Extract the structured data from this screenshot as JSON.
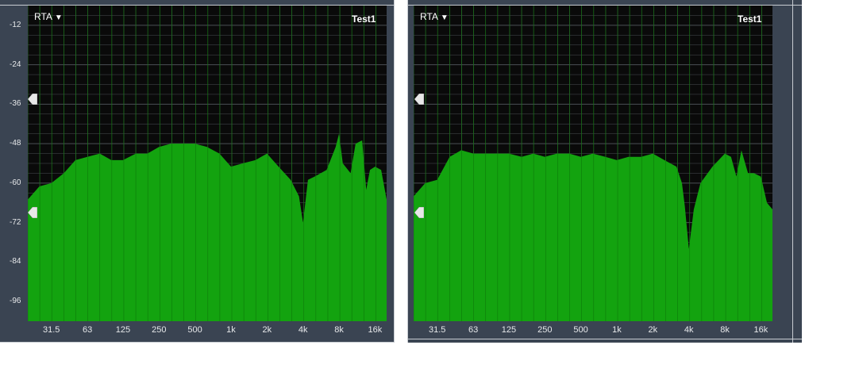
{
  "panels": [
    {
      "mode_label": "RTA",
      "trace_label": "Test1",
      "y_ticks": [
        "-12",
        "-24",
        "-36",
        "-48",
        "-60",
        "-72",
        "-84",
        "-96"
      ],
      "x_ticks": [
        "31.5",
        "63",
        "125",
        "250",
        "500",
        "1k",
        "2k",
        "4k",
        "8k",
        "16k"
      ]
    },
    {
      "mode_label": "RTA",
      "trace_label": "Test1",
      "x_ticks": [
        "31.5",
        "63",
        "125",
        "250",
        "500",
        "1k",
        "2k",
        "4k",
        "8k",
        "16k"
      ]
    }
  ],
  "colors": {
    "fill": "#13a30f",
    "grid": "#4a4f55",
    "background": "#0a0a0a"
  },
  "chart_data": [
    {
      "type": "area",
      "title": "Test1",
      "x_scale": "log",
      "ylim": [
        -102,
        -6
      ],
      "grid": true,
      "x": [
        20,
        25,
        31.5,
        40,
        50,
        63,
        80,
        100,
        125,
        160,
        200,
        250,
        315,
        400,
        500,
        630,
        800,
        1000,
        1250,
        1600,
        2000,
        2500,
        3150,
        3700,
        4000,
        4400,
        5000,
        6300,
        7500,
        8000,
        8600,
        10000,
        11000,
        12500,
        13500,
        14500,
        16000,
        18000,
        20000
      ],
      "y": [
        -65,
        -61,
        -60,
        -57,
        -53,
        -52,
        -51,
        -53,
        -53,
        -51,
        -51,
        -49,
        -48,
        -48,
        -48,
        -49,
        -51,
        -55,
        -54,
        -53,
        -51,
        -55,
        -59,
        -64,
        -72,
        -59,
        -58,
        -56,
        -49,
        -45,
        -54,
        -57,
        -48,
        -47,
        -62,
        -56,
        -55,
        -56,
        -65
      ]
    },
    {
      "type": "area",
      "title": "Test1",
      "x_scale": "log",
      "ylim": [
        -102,
        -6
      ],
      "grid": true,
      "x": [
        20,
        25,
        31.5,
        40,
        50,
        63,
        80,
        100,
        125,
        160,
        200,
        250,
        315,
        400,
        500,
        630,
        800,
        1000,
        1250,
        1600,
        2000,
        2500,
        3150,
        3500,
        3700,
        4000,
        4400,
        5000,
        6300,
        8000,
        9000,
        10000,
        11000,
        12500,
        14000,
        16000,
        18000,
        20000
      ],
      "y": [
        -64,
        -60,
        -59,
        -52,
        -50,
        -51,
        -51,
        -51,
        -51,
        -52,
        -51,
        -52,
        -51,
        -51,
        -52,
        -51,
        -52,
        -53,
        -52,
        -52,
        -51,
        -53,
        -55,
        -60,
        -67,
        -80,
        -68,
        -60,
        -55,
        -51,
        -52,
        -58,
        -50,
        -57,
        -57,
        -58,
        -66,
        -68
      ]
    }
  ]
}
